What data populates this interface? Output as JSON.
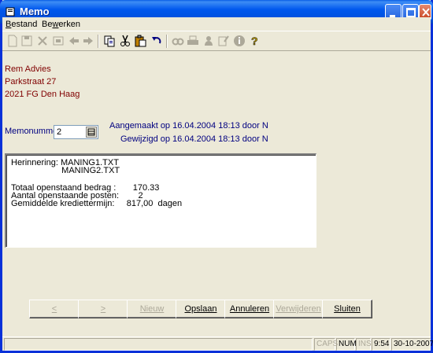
{
  "window": {
    "title": "Memo"
  },
  "menu": [
    {
      "label": "Bestand",
      "accel": "B",
      "rest": "estand"
    },
    {
      "label": "Bewerken",
      "pre": "Be",
      "accel": "w",
      "rest": "erken"
    }
  ],
  "toolbar": {
    "icons": [
      "new-icon",
      "save-icon",
      "delete-icon",
      "print-preview-icon",
      "back-arrow-icon",
      "forward-arrow-icon",
      "copy-icon",
      "cut-icon",
      "paste-icon",
      "undo-icon",
      "find-icon",
      "print-icon",
      "stamp-icon",
      "edit-icon",
      "info-icon",
      "help-icon"
    ]
  },
  "address": {
    "name": "Rem Advies",
    "street": "Parkstraat 27",
    "city": "2021 FG  Den Haag"
  },
  "memo": {
    "number_label": "Memonummer",
    "number_value": "2",
    "created": "Aangemaakt op 16.04.2004  18:13   door N",
    "modified": "Gewijzigd op 16.04.2004  18:13   door N",
    "lines": [
      "Herinnering: MANING1.TXT",
      "                     MANING2.TXT",
      "",
      "Totaal openstaand bedrag :       170.33",
      "Aantal openstaande posten:        2",
      "Gemiddelde krediettermijn:     817,00  dagen"
    ]
  },
  "buttons": {
    "prev": "<",
    "next": ">",
    "new": "Nieuw",
    "save": "Opslaan",
    "cancel": "Annuleren",
    "delete": "Verwijderen",
    "close": "Sluiten"
  },
  "status": {
    "caps": "CAPS",
    "num": "NUM",
    "ins": "INS",
    "time": "9:54",
    "date": "30-10-2007"
  }
}
